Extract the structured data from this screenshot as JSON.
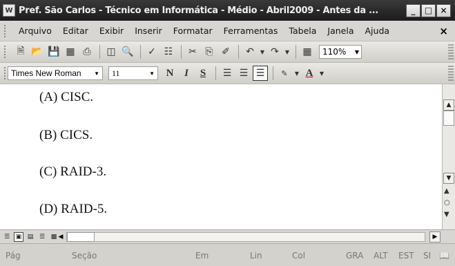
{
  "window": {
    "title": "Pref. São Carlos - Técnico em Informática - Médio - Abril2009 - Antes da ...",
    "icon_text": "W",
    "buttons": {
      "minimize": "_",
      "maximize": "□",
      "close": "×"
    }
  },
  "menubar": {
    "items": [
      "Arquivo",
      "Editar",
      "Exibir",
      "Inserir",
      "Formatar",
      "Ferramentas",
      "Tabela",
      "Janela",
      "Ajuda"
    ],
    "close_label": "×"
  },
  "standard_toolbar": {
    "icons": [
      "new-document",
      "open-folder",
      "save",
      "permission",
      "print",
      "print-preview",
      "spelling",
      "research",
      "cut",
      "copy",
      "format-painter",
      "undo",
      "redo",
      "insert-table"
    ],
    "zoom": "110%"
  },
  "formatting_toolbar": {
    "font_name": "Times New Roman",
    "font_size": "11",
    "bold": "N",
    "italic": "I",
    "underline": "S",
    "font_color_label": "A"
  },
  "document": {
    "lines": [
      "(A) CISC.",
      "(B) CICS.",
      "(C) RAID-3.",
      "(D) RAID-5."
    ]
  },
  "status_bar": {
    "page": "Pág",
    "section": "Seção",
    "at": "Em",
    "line": "Lin",
    "column": "Col",
    "rec": "GRA",
    "trk": "ALT",
    "ext": "EST",
    "ovr": "SI"
  }
}
